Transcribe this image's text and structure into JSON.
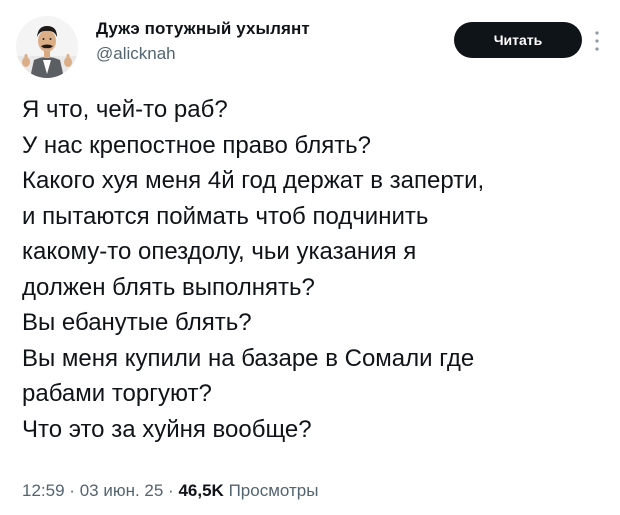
{
  "author": {
    "display_name": "Дужэ потужный ухылянт",
    "handle": "@alicknah"
  },
  "read_button_label": "Читать",
  "tweet_lines": [
    "Я что, чей-то раб?",
    "У нас крепостное право блять?",
    "Какого хуя меня 4й год держат в заперти,",
    "и пытаются поймать чтоб подчинить",
    "какому-то опездолу, чьи указания я",
    "должен блять выполнять?",
    "Вы ебанутые блять?",
    "Вы меня купили на базаре в Сомали где",
    "рабами торгуют?",
    "Что это за хуйня вообще?"
  ],
  "meta": {
    "time": "12:59",
    "separator": "·",
    "date": "03 июн. 25",
    "views_count": "46,5K",
    "views_label": "Просмотры"
  }
}
